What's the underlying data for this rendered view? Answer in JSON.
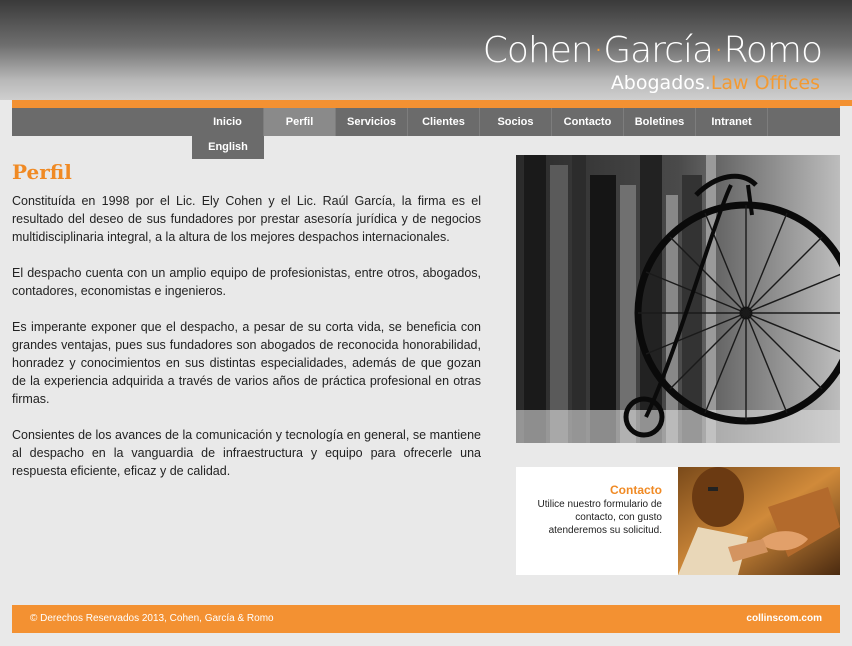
{
  "brand": {
    "name_part1": "Cohen",
    "separator": "·",
    "name_part2": "García",
    "name_part3": "Romo",
    "sub_part1": "Abogados.",
    "sub_part2": "Law Offices"
  },
  "nav": {
    "items": [
      {
        "label": "Inicio"
      },
      {
        "label": "Perfil"
      },
      {
        "label": "Servicios"
      },
      {
        "label": "Clientes"
      },
      {
        "label": "Socios"
      },
      {
        "label": "Contacto"
      },
      {
        "label": "Boletines"
      },
      {
        "label": "Intranet"
      }
    ],
    "active": "Perfil",
    "english_label": "English"
  },
  "page": {
    "title": "Perfil",
    "paragraphs": [
      "Constituída en 1998 por el Lic. Ely Cohen y el Lic. Raúl García, la firma es el resultado del deseo de sus fundadores por prestar asesoría jurídica y de negocios multidisciplinaria integral, a la altura de los mejores despachos internacionales.",
      "El despacho cuenta con un amplio equipo de profesionistas, entre otros, abogados, contadores, economistas e ingenieros.",
      "Es imperante exponer que el despacho, a pesar de su corta vida, se beneficia con grandes ventajas, pues sus fundadores son abogados de reconocida honorabilidad, honradez y conocimientos en sus distintas especialidades, además de que gozan de la experiencia adquirida a través de varios años de práctica profesional en otras firmas.",
      "Consientes de los avances de la comunicación y tecnología en general, se mantiene al despacho en la vanguardia de infraestructura y equipo para ofrecerle una respuesta eficiente, eficaz y de calidad."
    ]
  },
  "contact_box": {
    "title": "Contacto",
    "line1": "Utilice nuestro formulario de",
    "line2": "contacto, con gusto",
    "line3": "atenderemos su solicitud."
  },
  "footer": {
    "copyright": "© Derechos Reservados 2013, Cohen, García & Romo",
    "credit": "collinscom.com"
  },
  "colors": {
    "accent": "#f39132",
    "nav_bg": "#6b6b6b",
    "background": "#e9e9e9"
  }
}
